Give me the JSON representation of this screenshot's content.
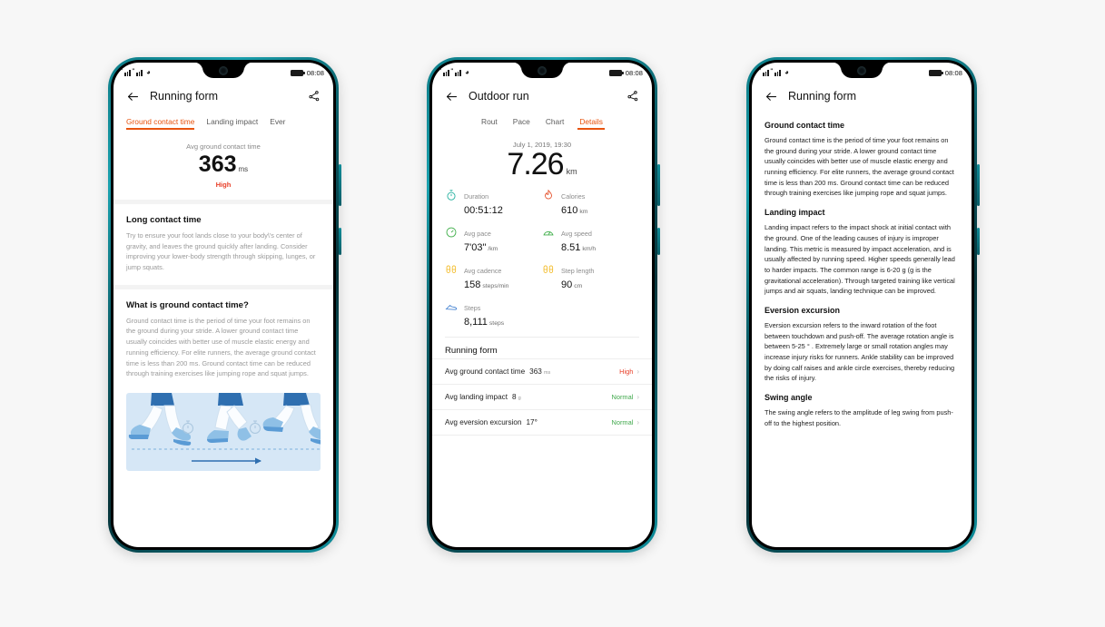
{
  "background_color": "#f7f7f7",
  "accent_color": "#e8530e",
  "status_high_color": "#e8402a",
  "status_normal_color": "#3fa84b",
  "status_bar": {
    "signal_label_1": "\"",
    "signal_label_2": "\"",
    "wifi_icon": "wifi-icon",
    "battery_icon": "battery-icon",
    "time": "08:08"
  },
  "phone1": {
    "appbar": {
      "back_icon": "back-arrow-icon",
      "title": "Running form",
      "share_icon": "share-icon"
    },
    "tabs": [
      {
        "label": "Ground contact time",
        "active": true
      },
      {
        "label": "Landing impact",
        "active": false
      },
      {
        "label": "Ever",
        "active": false
      }
    ],
    "hero": {
      "label": "Avg ground contact time",
      "value": "363",
      "unit": "ms",
      "status": "High"
    },
    "sections": [
      {
        "heading": "Long contact time",
        "body": "Try to ensure your foot lands close to your body\\'s center of gravity, and leaves the ground quickly after landing. Consider improving your lower-body strength through skipping, lunges, or jump squats."
      },
      {
        "heading": "What is ground contact time?",
        "body": "Ground contact time is the period of time your foot remains on the ground during your stride. A lower ground contact time usually coincides with better use of muscle elastic energy and running efficiency. For elite runners, the average ground contact time is less than 200 ms. Ground contact time can be reduced through training exercises like jumping rope and squat jumps."
      }
    ],
    "illustration": {
      "name": "running-stride-illustration",
      "background": "#d6e7f6"
    }
  },
  "phone2": {
    "appbar": {
      "back_icon": "back-arrow-icon",
      "title": "Outdoor run",
      "share_icon": "share-icon"
    },
    "tabs": [
      {
        "label": "Rout",
        "active": false
      },
      {
        "label": "Pace",
        "active": false
      },
      {
        "label": "Chart",
        "active": false
      },
      {
        "label": "Details",
        "active": true
      }
    ],
    "hero": {
      "date": "July 1, 2019, 19:30",
      "distance": "7.26",
      "distance_unit": "km"
    },
    "metrics": [
      {
        "icon": "stopwatch-icon",
        "icon_color": "#1eae9c",
        "label": "Duration",
        "value": "00:51:12",
        "unit": ""
      },
      {
        "icon": "flame-icon",
        "icon_color": "#e4502a",
        "label": "Calories",
        "value": "610",
        "unit": "km"
      },
      {
        "icon": "pace-gauge-icon",
        "icon_color": "#3fae49",
        "label": "Avg pace",
        "value": "7'03\"",
        "unit": "/km"
      },
      {
        "icon": "speedometer-icon",
        "icon_color": "#3fae49",
        "label": "Avg speed",
        "value": "8.51",
        "unit": "km/h"
      },
      {
        "icon": "footprints-icon",
        "icon_color": "#f2b81e",
        "label": "Avg cadence",
        "value": "158",
        "unit": "steps/min"
      },
      {
        "icon": "footprints-icon",
        "icon_color": "#f2b81e",
        "label": "Step length",
        "value": "90",
        "unit": "cm"
      },
      {
        "icon": "shoe-icon",
        "icon_color": "#3f7fd0",
        "label": "Steps",
        "value": "8,111",
        "unit": "steps"
      }
    ],
    "list": {
      "title": "Running form",
      "rows": [
        {
          "label": "Avg ground contact time",
          "value": "363",
          "unit": "ms",
          "status": "High",
          "status_type": "high",
          "chevron": "chevron-right-icon"
        },
        {
          "label": "Avg landing impact",
          "value": "8",
          "unit": "g",
          "status": "Normal",
          "status_type": "normal",
          "chevron": "chevron-right-icon"
        },
        {
          "label": "Avg eversion excursion",
          "value": "17°",
          "unit": "",
          "status": "Normal",
          "status_type": "normal",
          "chevron": "chevron-right-icon"
        }
      ]
    }
  },
  "phone3": {
    "appbar": {
      "back_icon": "back-arrow-icon",
      "title": "Running form"
    },
    "sections": [
      {
        "heading": "Ground contact time",
        "body": "Ground contact time is the period of time your foot remains on the ground during your stride. A lower ground contact time usually coincides with better use of muscle elastic energy and running efficiency. For elite runners, the average ground contact time is less than 200 ms. Ground contact time can be reduced through training exercises like jumping rope and squat jumps."
      },
      {
        "heading": "Landing impact",
        "body": "Landing impact refers to the impact shock at initial contact with the ground. One of the leading causes of injury is improper landing. This metric is measured by impact acceleration, and is usually affected by running speed. Higher speeds generally lead to harder impacts. The common range is 6-20 g (g is the gravitational acceleration). Through targeted training like vertical jumps and air squats, landing technique can be improved."
      },
      {
        "heading": "Eversion excursion",
        "body": "Eversion excursion refers to the inward rotation of the foot between touchdown and push-off. The average rotation angle is between 5-25 ° . Extremely large or small rotation angles may increase injury risks for runners. Ankle stability can be improved by doing calf raises and ankle circle exercises, thereby reducing the risks of injury."
      },
      {
        "heading": "Swing angle",
        "body": "The swing angle refers to the amplitude of leg swing from push-off to the highest position."
      }
    ]
  }
}
